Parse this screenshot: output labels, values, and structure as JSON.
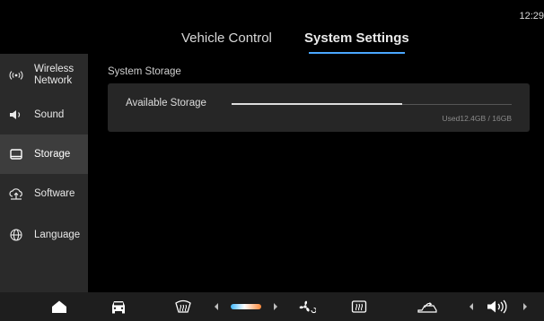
{
  "status_bar": {
    "time": "12:29"
  },
  "tabs": [
    {
      "label": "Vehicle Control",
      "active": false
    },
    {
      "label": "System Settings",
      "active": true
    }
  ],
  "sidebar": {
    "items": [
      {
        "label": "Wireless Network",
        "icon": "wireless-icon",
        "active": false
      },
      {
        "label": "Sound",
        "icon": "speaker-icon",
        "active": false
      },
      {
        "label": "Storage",
        "icon": "storage-icon",
        "active": true
      },
      {
        "label": "Software",
        "icon": "software-update-icon",
        "active": false
      },
      {
        "label": "Language",
        "icon": "globe-icon",
        "active": false
      }
    ]
  },
  "main": {
    "section_title": "System Storage",
    "storage": {
      "label": "Available Storage",
      "used_fraction": 0.61,
      "usage_text": "Used12.4GB / 16GB"
    }
  },
  "dock": {
    "items": [
      {
        "icon": "home-icon"
      },
      {
        "icon": "car-icon"
      },
      {
        "icon": "front-defrost-icon"
      },
      {
        "icon": "temperature-decrease-icon"
      },
      {
        "icon": "temperature-bar"
      },
      {
        "icon": "temperature-increase-icon"
      },
      {
        "icon": "fan-icon"
      },
      {
        "icon": "rear-defrost-icon"
      },
      {
        "icon": "air-recirculation-icon"
      },
      {
        "icon": "volume-decrease-icon"
      },
      {
        "icon": "volume-icon"
      },
      {
        "icon": "volume-increase-icon"
      }
    ],
    "colors": {
      "accent": "#4aa7ff",
      "cold": "#3fb8ff",
      "hot": "#ff8a3a"
    }
  }
}
